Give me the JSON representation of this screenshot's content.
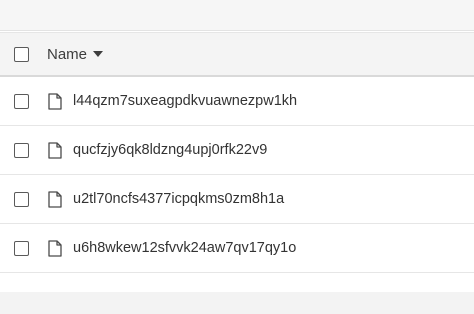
{
  "table": {
    "header": {
      "name_label": "Name"
    },
    "rows": [
      {
        "name": "l44qzm7suxeagpdkvuawnezpw1kh"
      },
      {
        "name": "qucfzjy6qk8ldzng4upj0rfk22v9"
      },
      {
        "name": "u2tl70ncfs4377icpqkms0zm8h1a"
      },
      {
        "name": "u6h8wkew12sfvvk24aw7qv17qy1o"
      }
    ]
  }
}
